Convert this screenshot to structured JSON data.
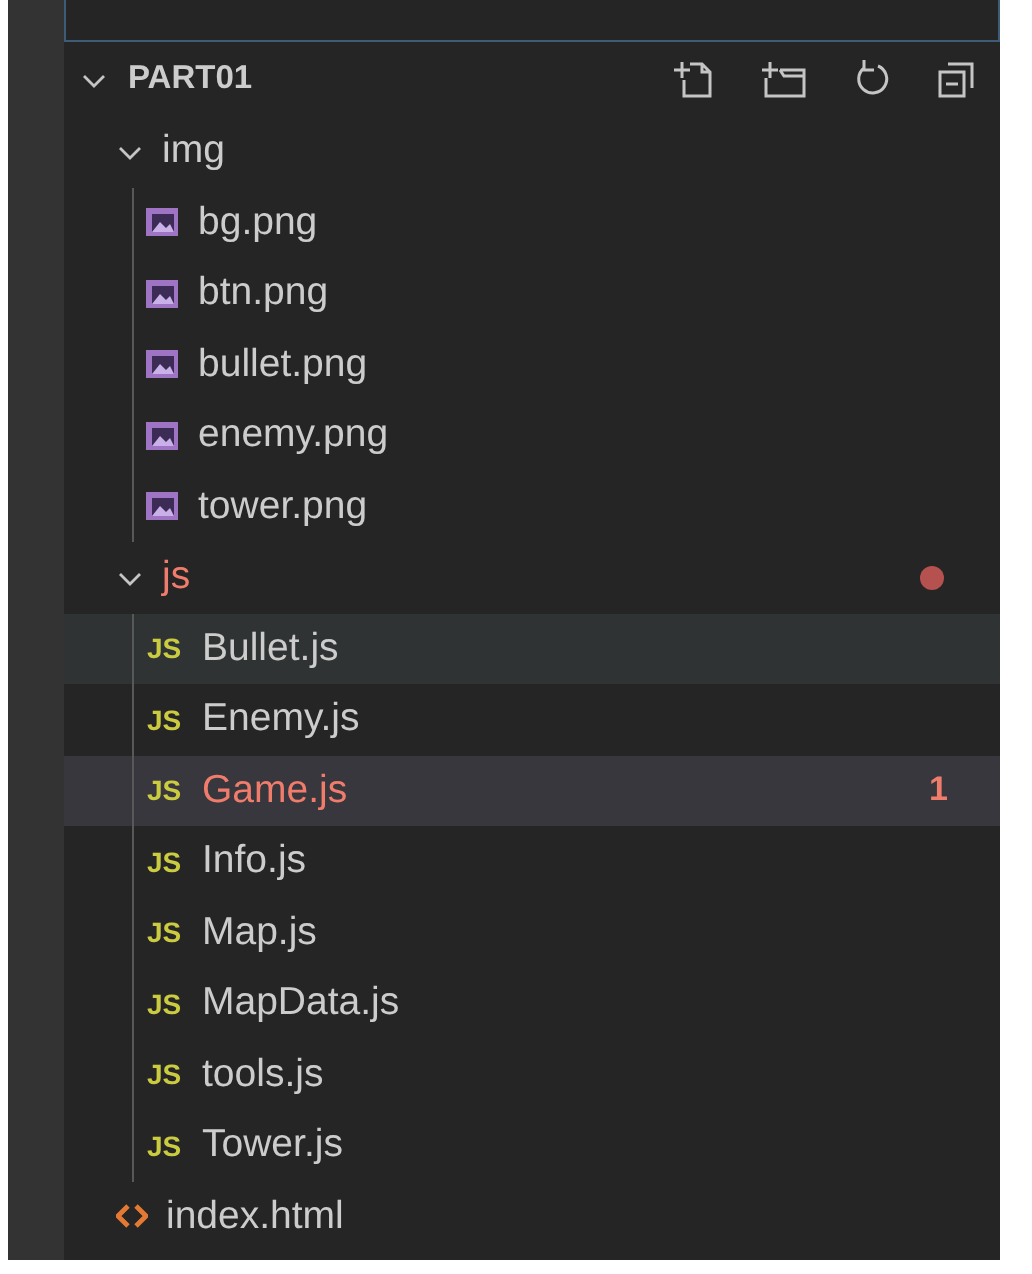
{
  "explorer": {
    "title": "PART01",
    "expanded": true,
    "tree": [
      {
        "name": "img",
        "kind": "folder",
        "expanded": true,
        "error": false,
        "selected": false,
        "hovered": false,
        "children": [
          {
            "name": "bg.png",
            "kind": "image",
            "error": false,
            "selected": false,
            "hovered": false
          },
          {
            "name": "btn.png",
            "kind": "image",
            "error": false,
            "selected": false,
            "hovered": false
          },
          {
            "name": "bullet.png",
            "kind": "image",
            "error": false,
            "selected": false,
            "hovered": false
          },
          {
            "name": "enemy.png",
            "kind": "image",
            "error": false,
            "selected": false,
            "hovered": false
          },
          {
            "name": "tower.png",
            "kind": "image",
            "error": false,
            "selected": false,
            "hovered": false
          }
        ]
      },
      {
        "name": "js",
        "kind": "folder",
        "expanded": true,
        "error": true,
        "selected": false,
        "hovered": false,
        "children": [
          {
            "name": "Bullet.js",
            "kind": "script",
            "icon_label": "JS",
            "error": false,
            "selected": false,
            "hovered": true
          },
          {
            "name": "Enemy.js",
            "kind": "script",
            "icon_label": "JS",
            "error": false,
            "selected": false,
            "hovered": false
          },
          {
            "name": "Game.js",
            "kind": "script",
            "icon_label": "JS",
            "error": true,
            "badge": "1",
            "selected": true,
            "hovered": false
          },
          {
            "name": "Info.js",
            "kind": "script",
            "icon_label": "JS",
            "error": false,
            "selected": false,
            "hovered": false
          },
          {
            "name": "Map.js",
            "kind": "script",
            "icon_label": "JS",
            "error": false,
            "selected": false,
            "hovered": false
          },
          {
            "name": "MapData.js",
            "kind": "script",
            "icon_label": "JS",
            "error": false,
            "selected": false,
            "hovered": false
          },
          {
            "name": "tools.js",
            "kind": "script",
            "icon_label": "JS",
            "error": false,
            "selected": false,
            "hovered": false
          },
          {
            "name": "Tower.js",
            "kind": "script",
            "icon_label": "JS",
            "error": false,
            "selected": false,
            "hovered": false
          }
        ]
      },
      {
        "name": "index.html",
        "kind": "markup",
        "error": false,
        "selected": false,
        "hovered": false
      }
    ]
  }
}
